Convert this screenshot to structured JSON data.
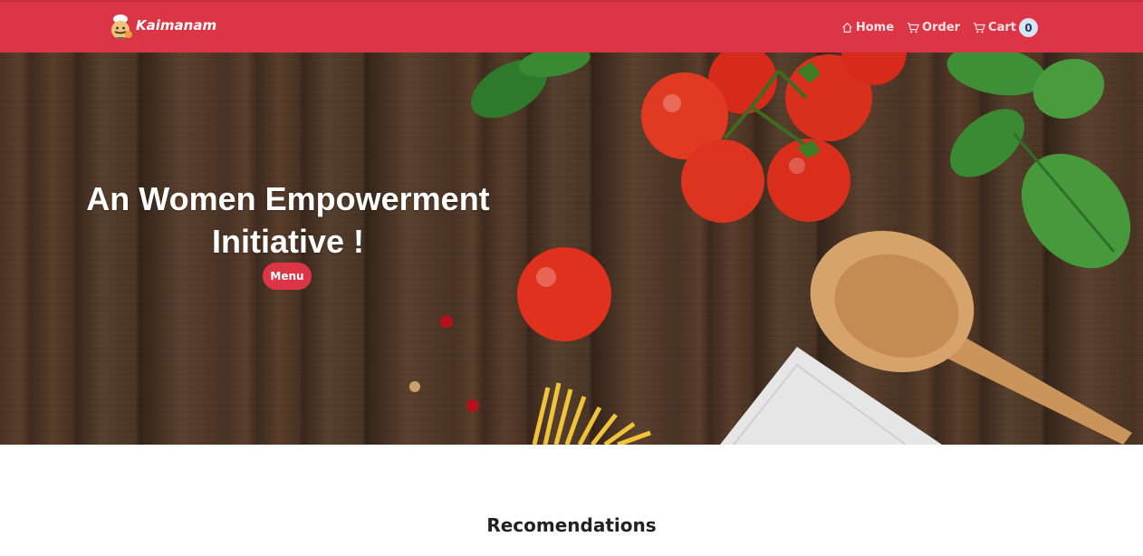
{
  "navbar": {
    "brand": "Kaimanam",
    "links": [
      {
        "label": "Home",
        "icon": "home-icon"
      },
      {
        "label": "Order",
        "icon": "cart-icon"
      },
      {
        "label": "Cart",
        "icon": "cart-icon"
      }
    ],
    "cart_count": "0",
    "background": "#dc3545"
  },
  "hero": {
    "title_line1": "An Women Empowerment",
    "title_line2": "Initiative !",
    "menu_button": "Menu"
  },
  "sections": {
    "recommendations_title": "Recomendations"
  },
  "colors": {
    "accent": "#dc3545",
    "badge": "#d7e6f7"
  }
}
